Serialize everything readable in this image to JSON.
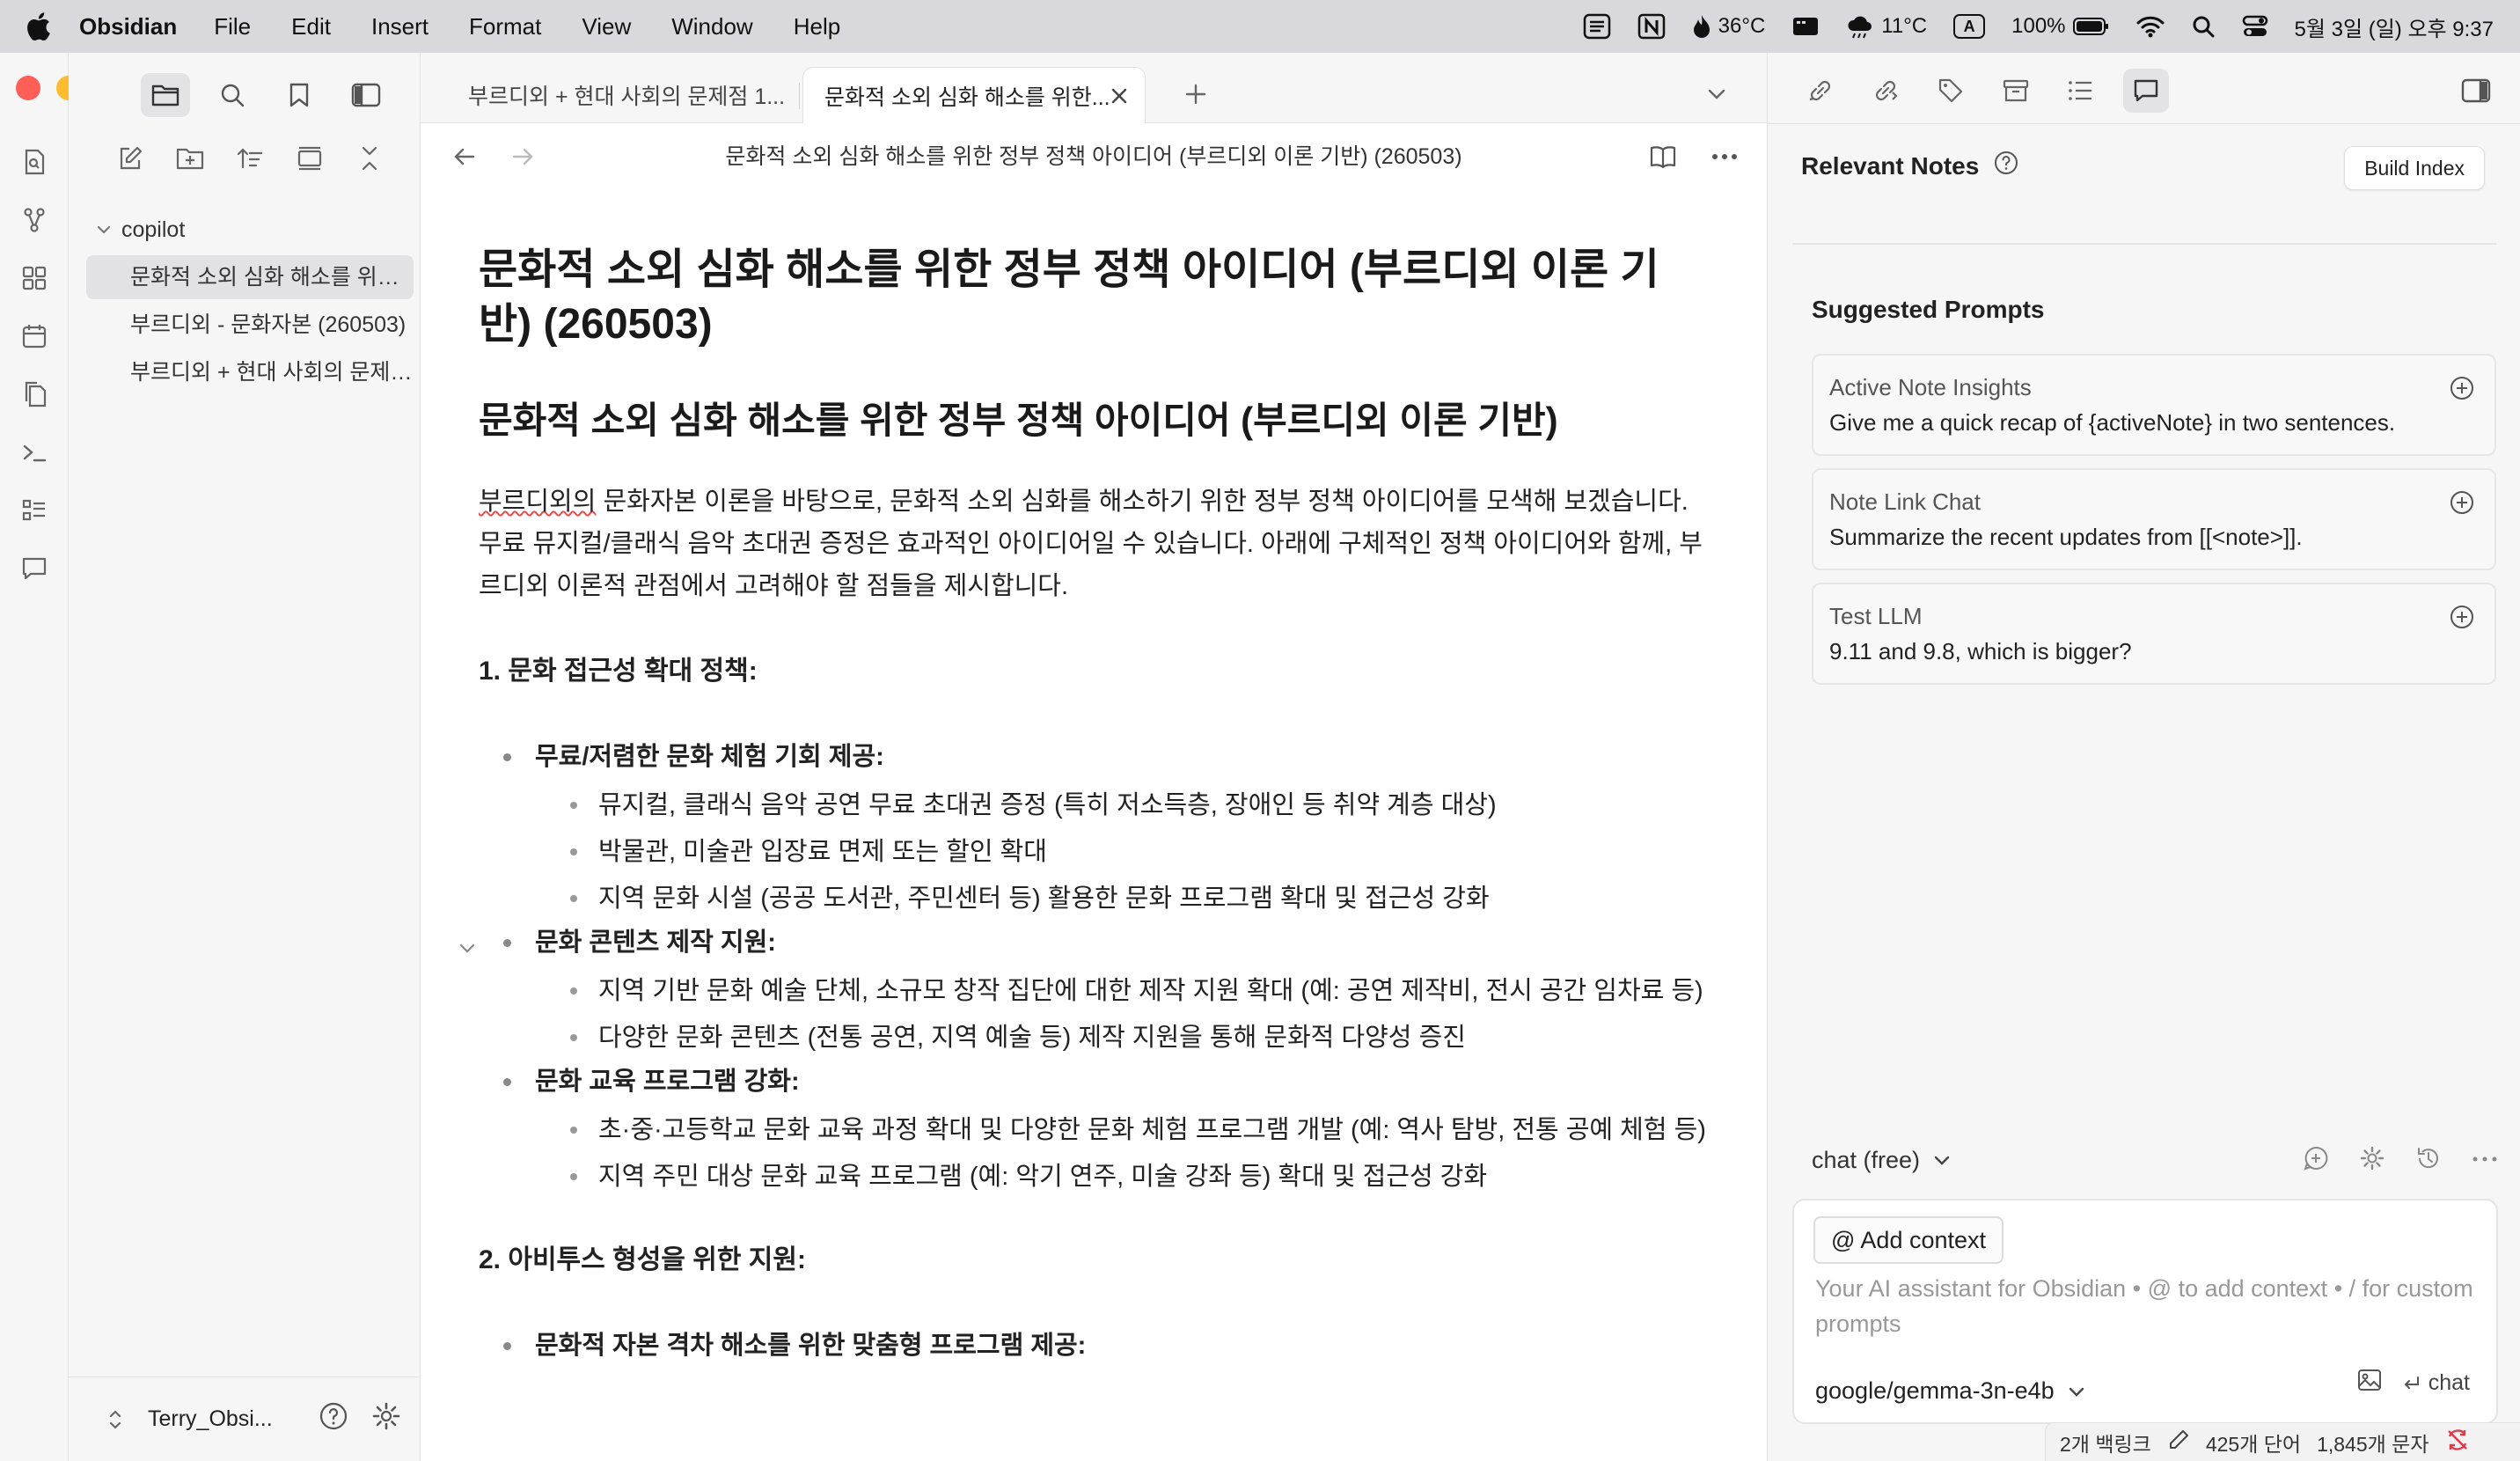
{
  "menubar": {
    "app": "Obsidian",
    "items": [
      "File",
      "Edit",
      "Insert",
      "Format",
      "View",
      "Window",
      "Help"
    ],
    "temp_flame": "36°C",
    "weather": "11°C",
    "input_lang": "A",
    "battery": "100%",
    "datetime": "5월 3일 (일) 오후 9:37"
  },
  "sidebar": {
    "folder": "copilot",
    "files": [
      "문화적 소외 심화 해소를 위한 정부 정책 아이디어 (부르디외 이론 기반) (260503)",
      "부르디외 - 문화자본 (260503)",
      "부르디외 + 현대 사회의 문제점 (260503)"
    ],
    "vault_name": "Terry_Obsi..."
  },
  "tabs": [
    {
      "label": "부르디외 + 현대 사회의 문제점 1..."
    },
    {
      "label": "문화적 소외 심화 해소를 위한..."
    }
  ],
  "editor": {
    "header_title": "문화적 소외 심화 해소를 위한 정부 정책 아이디어 (부르디외 이론 기반) (260503)",
    "h1": "문화적 소외 심화 해소를 위한 정부 정책 아이디어 (부르디외 이론 기반) (260503)",
    "h2": "문화적 소외 심화 해소를 위한 정부 정책 아이디어 (부르디외 이론 기반)",
    "intro_misspelled": "부르디외의",
    "intro_rest": " 문화자본 이론을 바탕으로, 문화적 소외 심화를 해소하기 위한 정부 정책 아이디어를 모색해 보겠습니다. 무료 뮤지컬/클래식 음악 초대권 증정은 효과적인 아이디어일 수 있습니다. 아래에 구체적인 정책 아이디어와 함께, 부르디외 이론적 관점에서 고려해야 할 점들을 제시합니다.",
    "section1": "1. 문화 접근성 확대 정책:",
    "bullets": [
      {
        "label": "무료/저렴한 문화 체험 기회 제공:",
        "items": [
          "뮤지컬, 클래식 음악 공연 무료 초대권 증정 (특히 저소득층, 장애인 등 취약 계층 대상)",
          "박물관, 미술관 입장료 면제 또는 할인 확대",
          "지역 문화 시설 (공공 도서관, 주민센터 등) 활용한 문화 프로그램 확대 및 접근성 강화"
        ]
      },
      {
        "label": "문화 콘텐츠 제작 지원:",
        "items": [
          "지역 기반 문화 예술 단체, 소규모 창작 집단에 대한 제작 지원 확대 (예: 공연 제작비, 전시 공간 임차료 등)",
          "다양한 문화 콘텐츠 (전통 공연, 지역 예술 등) 제작 지원을 통해 문화적 다양성 증진"
        ]
      },
      {
        "label": "문화 교육 프로그램 강화:",
        "items": [
          "초·중·고등학교 문화 교육 과정 확대 및 다양한 문화 체험 프로그램 개발 (예: 역사 탐방, 전통 공예 체험 등)",
          "지역 주민 대상 문화 교육 프로그램 (예: 악기 연주, 미술 강좌 등) 확대 및 접근성 강화"
        ]
      }
    ],
    "section2": "2. 아비투스 형성을 위한 지원:",
    "bullet_partial": "문화적 자본 격차 해소를 위한 맞춤형 프로그램 제공:"
  },
  "copilot": {
    "relevant_title": "Relevant Notes",
    "build_index": "Build Index",
    "suggested_title": "Suggested Prompts",
    "prompts": [
      {
        "title": "Active Note Insights",
        "body": "Give me a quick recap of {activeNote} in two sentences."
      },
      {
        "title": "Note Link Chat",
        "body": "Summarize the recent updates from [[<note>]]."
      },
      {
        "title": "Test LLM",
        "body": "9.11 and 9.8, which is bigger?"
      }
    ],
    "mode": "chat (free)",
    "add_context": "@ Add context",
    "placeholder": "Your AI assistant for Obsidian • @ to add context • / for custom prompts",
    "model": "google/gemma-3n-e4b",
    "send_label": "chat"
  },
  "statusbar": {
    "backlinks": "2개 백링크",
    "words": "425개 단어",
    "chars": "1,845개 문자"
  },
  "colors": {
    "traffic_red": "#ff5f57",
    "traffic_yellow": "#febc2e",
    "traffic_green": "#28c840"
  }
}
